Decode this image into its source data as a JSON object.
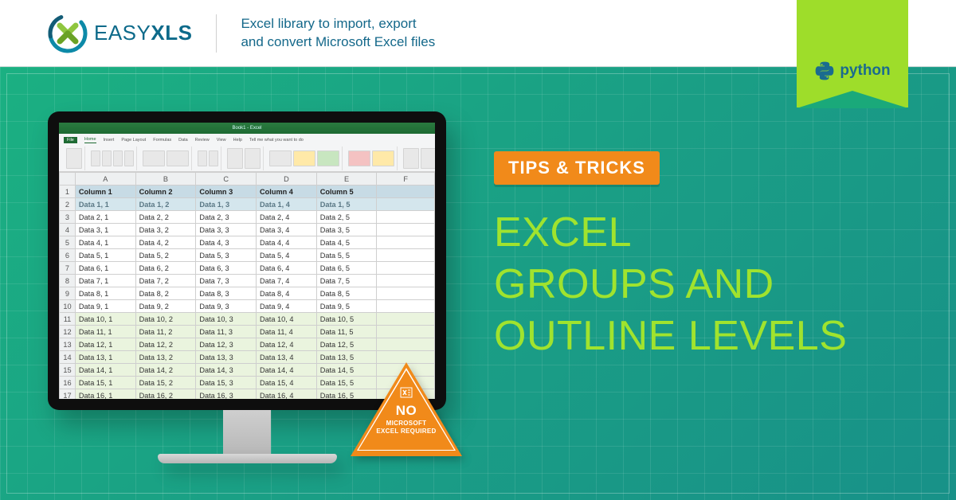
{
  "header": {
    "logo_text_light": "EASY",
    "logo_text_bold": "XLS",
    "tagline_l1": "Excel library to import, export",
    "tagline_l2": "and convert Microsoft Excel files"
  },
  "ribbon": {
    "language": "python"
  },
  "badge": "TIPS & TRICKS",
  "title_l1": "EXCEL",
  "title_l2": "GROUPS AND",
  "title_l3": "OUTLINE LEVELS",
  "excel": {
    "title": "Book1 - Excel",
    "menu_tabs": [
      "File",
      "Home",
      "Insert",
      "Page Layout",
      "Formulas",
      "Data",
      "Review",
      "View",
      "Help",
      "Tell me what you want to do"
    ],
    "col_letters": [
      "",
      "A",
      "B",
      "C",
      "D",
      "E",
      "F"
    ],
    "columns": [
      "Column 1",
      "Column 2",
      "Column 3",
      "Column 4",
      "Column 5"
    ],
    "rows": [
      [
        "Data 1, 1",
        "Data 1, 2",
        "Data 1, 3",
        "Data 1, 4",
        "Data 1, 5"
      ],
      [
        "Data 2, 1",
        "Data 2, 2",
        "Data 2, 3",
        "Data 2, 4",
        "Data 2, 5"
      ],
      [
        "Data 3, 1",
        "Data 3, 2",
        "Data 3, 3",
        "Data 3, 4",
        "Data 3, 5"
      ],
      [
        "Data 4, 1",
        "Data 4, 2",
        "Data 4, 3",
        "Data 4, 4",
        "Data 4, 5"
      ],
      [
        "Data 5, 1",
        "Data 5, 2",
        "Data 5, 3",
        "Data 5, 4",
        "Data 5, 5"
      ],
      [
        "Data 6, 1",
        "Data 6, 2",
        "Data 6, 3",
        "Data 6, 4",
        "Data 6, 5"
      ],
      [
        "Data 7, 1",
        "Data 7, 2",
        "Data 7, 3",
        "Data 7, 4",
        "Data 7, 5"
      ],
      [
        "Data 8, 1",
        "Data 8, 2",
        "Data 8, 3",
        "Data 8, 4",
        "Data 8, 5"
      ],
      [
        "Data 9, 1",
        "Data 9, 2",
        "Data 9, 3",
        "Data 9, 4",
        "Data 9, 5"
      ],
      [
        "Data 10, 1",
        "Data 10, 2",
        "Data 10, 3",
        "Data 10, 4",
        "Data 10, 5"
      ],
      [
        "Data 11, 1",
        "Data 11, 2",
        "Data 11, 3",
        "Data 11, 4",
        "Data 11, 5"
      ],
      [
        "Data 12, 1",
        "Data 12, 2",
        "Data 12, 3",
        "Data 12, 4",
        "Data 12, 5"
      ],
      [
        "Data 13, 1",
        "Data 13, 2",
        "Data 13, 3",
        "Data 13, 4",
        "Data 13, 5"
      ],
      [
        "Data 14, 1",
        "Data 14, 2",
        "Data 14, 3",
        "Data 14, 4",
        "Data 14, 5"
      ],
      [
        "Data 15, 1",
        "Data 15, 2",
        "Data 15, 3",
        "Data 15, 4",
        "Data 15, 5"
      ],
      [
        "Data 16, 1",
        "Data 16, 2",
        "Data 16, 3",
        "Data 16, 4",
        "Data 16, 5"
      ]
    ],
    "group_start_row_index": 9
  },
  "warning": {
    "no": "NO",
    "l1": "MICROSOFT",
    "l2": "EXCEL REQUIRED"
  }
}
